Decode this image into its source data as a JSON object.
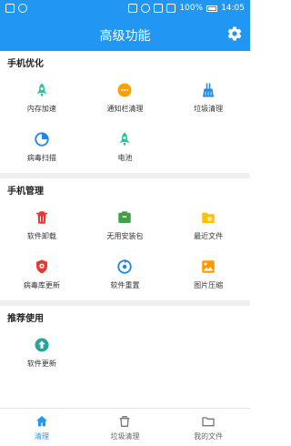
{
  "status_bar": {
    "battery": "100%",
    "time": "14:05"
  },
  "app_bar": {
    "title": "高级功能"
  },
  "sections": [
    {
      "title": "手机优化",
      "items": [
        {
          "label": "内存加速",
          "icon": "rocket-icon",
          "color": "#26C6A0"
        },
        {
          "label": "通知栏清理",
          "icon": "notification-dots-icon",
          "color": "#FFA000"
        },
        {
          "label": "垃圾清理",
          "icon": "broom-icon",
          "color": "#1E88E5"
        },
        {
          "label": "病毒扫描",
          "icon": "scan-icon",
          "color": "#1E88E5"
        },
        {
          "label": "电池",
          "icon": "battery-rocket-icon",
          "color": "#26C6A0"
        }
      ]
    },
    {
      "title": "手机管理",
      "items": [
        {
          "label": "软件卸载",
          "icon": "trash-icon",
          "color": "#E53935"
        },
        {
          "label": "无用安装包",
          "icon": "package-icon",
          "color": "#43A047"
        },
        {
          "label": "最近文件",
          "icon": "folder-icon",
          "color": "#FFC107"
        },
        {
          "label": "病毒库更新",
          "icon": "shield-update-icon",
          "color": "#E53935"
        },
        {
          "label": "软件重置",
          "icon": "reset-icon",
          "color": "#1E88E5"
        },
        {
          "label": "图片压缩",
          "icon": "image-icon",
          "color": "#FF9800"
        }
      ]
    },
    {
      "title": "推荐使用",
      "items": [
        {
          "label": "软件更新",
          "icon": "update-arrow-icon",
          "color": "#26A69A"
        }
      ]
    }
  ],
  "bottom_nav": [
    {
      "label": "清理",
      "icon": "home-icon",
      "active": true
    },
    {
      "label": "垃圾清理",
      "icon": "trash-tab-icon",
      "active": false
    },
    {
      "label": "我的文件",
      "icon": "folder-tab-icon",
      "active": false
    }
  ],
  "colors": {
    "primary": "#2196F3",
    "divider": "#efefef"
  }
}
